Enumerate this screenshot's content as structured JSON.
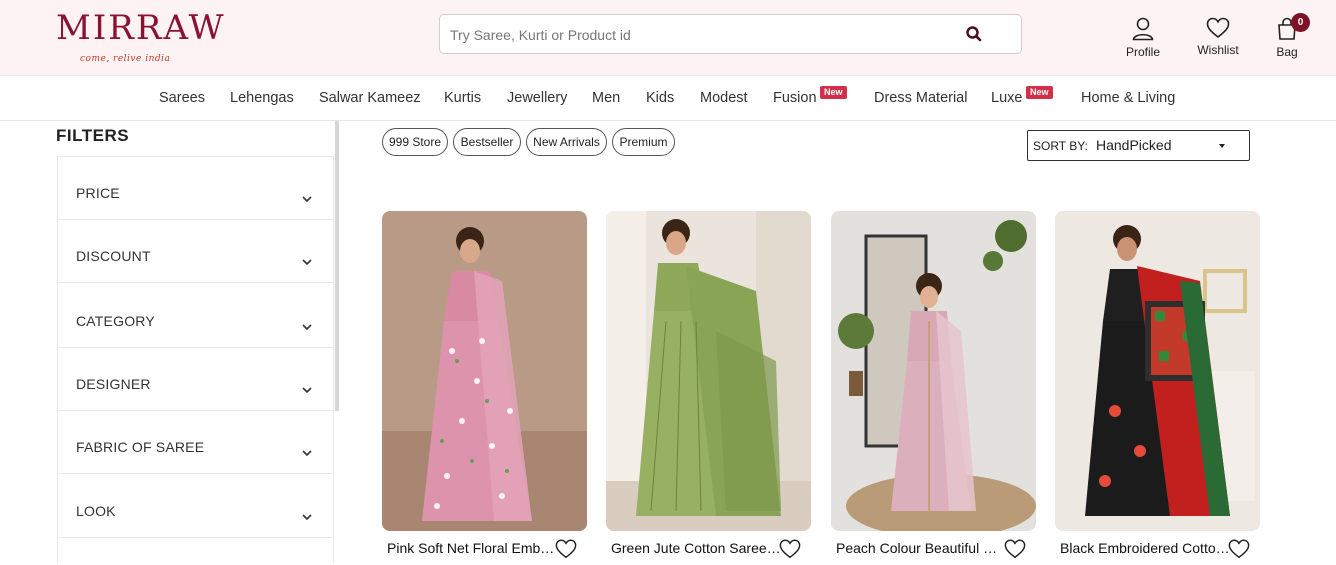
{
  "brand": {
    "name": "MIRRAW",
    "tagline": "come, relive india"
  },
  "search": {
    "placeholder": "Try Saree, Kurti or Product id",
    "icon": "search-icon"
  },
  "header_links": {
    "profile": "Profile",
    "wishlist": "Wishlist",
    "bag": "Bag",
    "bag_count": "0"
  },
  "nav": {
    "items": [
      "Sarees",
      "Lehengas",
      "Salwar Kameez",
      "Kurtis",
      "Jewellery",
      "Men",
      "Kids",
      "Modest",
      "Fusion",
      "Dress Material",
      "Luxe",
      "Home & Living"
    ],
    "new_badge": "New"
  },
  "filters": {
    "title": "FILTERS",
    "items": [
      "PRICE",
      "DISCOUNT",
      "CATEGORY",
      "DESIGNER",
      "FABRIC OF SAREE",
      "LOOK"
    ]
  },
  "chips": [
    "999 Store",
    "Bestseller",
    "New Arrivals",
    "Premium"
  ],
  "sort": {
    "prefix": "SORT BY:",
    "value": "HandPicked"
  },
  "products": [
    {
      "title": "Pink Soft Net Floral Embroidered Saree"
    },
    {
      "title": "Green Jute Cotton Saree with Tassels"
    },
    {
      "title": "Peach Colour Beautiful Organza Saree"
    },
    {
      "title": "Black Embroidered Cotton Saree"
    }
  ],
  "colors": {
    "header_bg": "#fdf3f3",
    "brand": "#8a1233",
    "badge": "#d2304a",
    "bag_badge": "#7d1128"
  }
}
